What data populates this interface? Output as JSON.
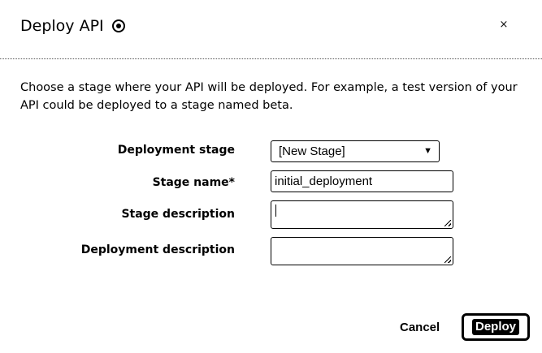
{
  "dialog": {
    "title": "Deploy API",
    "close_label": "×",
    "intro": "Choose a stage where your API will be deployed. For example, a test version of your API could be deployed to a stage named beta."
  },
  "form": {
    "deployment_stage": {
      "label": "Deployment stage",
      "value": "[New Stage]",
      "arrow": "▼"
    },
    "stage_name": {
      "label": "Stage name*",
      "value": "initial_deployment"
    },
    "stage_description": {
      "label": "Stage description",
      "value": ""
    },
    "deployment_description": {
      "label": "Deployment description",
      "value": ""
    }
  },
  "actions": {
    "cancel_label": "Cancel",
    "deploy_label": "Deploy"
  },
  "icons": {
    "title_icon": "info-icon",
    "close": "close-icon",
    "select_arrow": "chevron-down-icon"
  }
}
